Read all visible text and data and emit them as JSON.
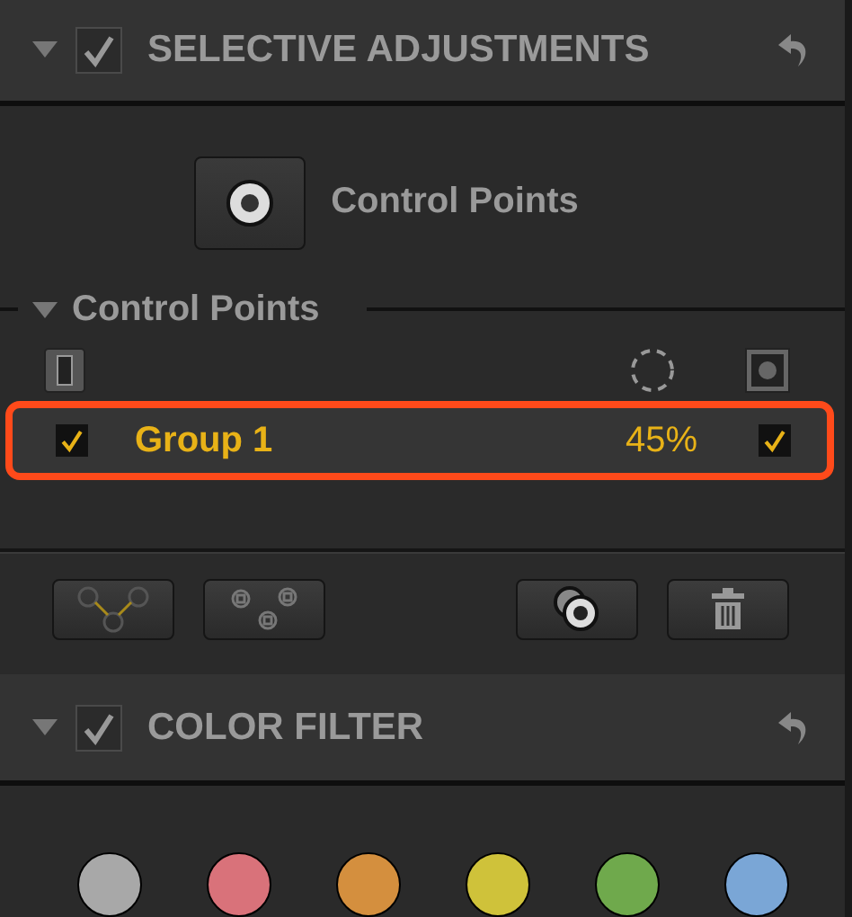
{
  "selective_adjustments": {
    "title": "SELECTIVE ADJUSTMENTS",
    "expanded": true,
    "checked": true
  },
  "control_points_button": {
    "label": "Control Points"
  },
  "control_points": {
    "title": "Control Points",
    "expanded": true,
    "groups": [
      {
        "name": "Group 1",
        "opacity": "45%",
        "visible": true,
        "selected": true,
        "mask": true
      }
    ]
  },
  "color_filter": {
    "title": "COLOR FILTER",
    "expanded": true,
    "checked": true,
    "swatches": [
      {
        "color": "#a8a8a8"
      },
      {
        "color": "#d9727a"
      },
      {
        "color": "#d48f3e"
      },
      {
        "color": "#cfc23a"
      },
      {
        "color": "#6fa94c"
      },
      {
        "color": "#7aa6d6"
      }
    ]
  }
}
